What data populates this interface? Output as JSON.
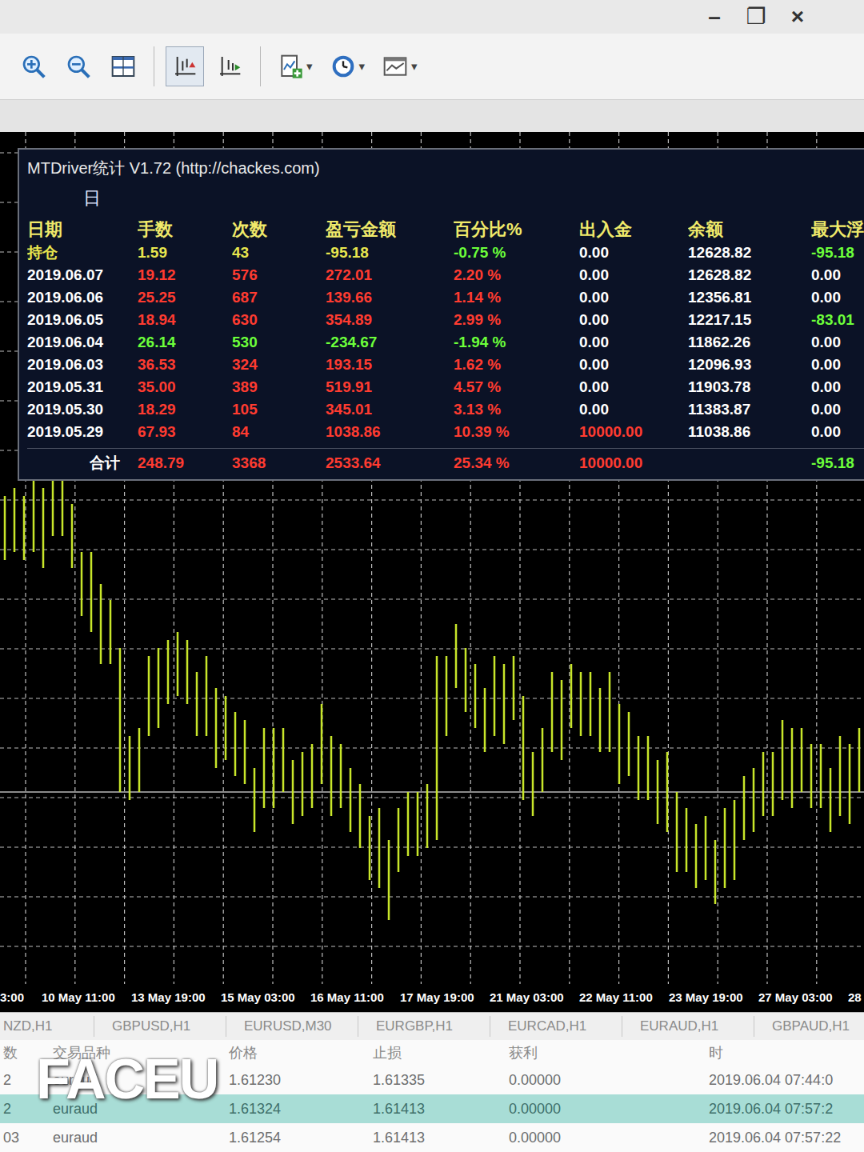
{
  "window": {
    "controls": [
      "–",
      "❐",
      "×"
    ]
  },
  "toolbar": {
    "buttons": [
      {
        "kind": "button",
        "selected": false
      },
      {
        "kind": "button",
        "selected": false
      },
      {
        "kind": "button",
        "selected": false
      },
      {
        "kind": "toggle",
        "selected": true
      },
      {
        "kind": "toggle",
        "selected": false
      },
      {
        "kind": "dropdown",
        "selected": false,
        "arrow": "▾"
      },
      {
        "kind": "dropdown",
        "selected": false,
        "arrow": "▾"
      },
      {
        "kind": "dropdown",
        "selected": false,
        "arrow": "▾"
      }
    ]
  },
  "stats_panel": {
    "title": "MTDriver统计 V1.72 (http://chackes.com)",
    "tab": "日",
    "columns": [
      "日期",
      "手数",
      "次数",
      "盈亏金额",
      "百分比%",
      "出入金",
      "余额",
      "最大浮"
    ],
    "rows": [
      {
        "cells": [
          "持仓",
          "1.59",
          "43",
          "-95.18",
          "-0.75 %",
          "0.00",
          "12628.82",
          "-95.18"
        ],
        "colors": [
          "#e8e64e",
          "#e8e64e",
          "#e8e64e",
          "#e8e64e",
          "#6cff3a",
          "#ffffff",
          "#ffffff",
          "#6cff3a"
        ]
      },
      {
        "cells": [
          "2019.06.07",
          "19.12",
          "576",
          "272.01",
          "2.20 %",
          "0.00",
          "12628.82",
          "0.00"
        ],
        "colors": [
          "#ffffff",
          "#ff3b30",
          "#ff3b30",
          "#ff3b30",
          "#ff3b30",
          "#ffffff",
          "#ffffff",
          "#ffffff"
        ]
      },
      {
        "cells": [
          "2019.06.06",
          "25.25",
          "687",
          "139.66",
          "1.14 %",
          "0.00",
          "12356.81",
          "0.00"
        ],
        "colors": [
          "#ffffff",
          "#ff3b30",
          "#ff3b30",
          "#ff3b30",
          "#ff3b30",
          "#ffffff",
          "#ffffff",
          "#ffffff"
        ]
      },
      {
        "cells": [
          "2019.06.05",
          "18.94",
          "630",
          "354.89",
          "2.99 %",
          "0.00",
          "12217.15",
          "-83.01"
        ],
        "colors": [
          "#ffffff",
          "#ff3b30",
          "#ff3b30",
          "#ff3b30",
          "#ff3b30",
          "#ffffff",
          "#ffffff",
          "#6cff3a"
        ]
      },
      {
        "cells": [
          "2019.06.04",
          "26.14",
          "530",
          "-234.67",
          "-1.94 %",
          "0.00",
          "11862.26",
          "0.00"
        ],
        "colors": [
          "#ffffff",
          "#6cff3a",
          "#6cff3a",
          "#6cff3a",
          "#6cff3a",
          "#ffffff",
          "#ffffff",
          "#ffffff"
        ]
      },
      {
        "cells": [
          "2019.06.03",
          "36.53",
          "324",
          "193.15",
          "1.62 %",
          "0.00",
          "12096.93",
          "0.00"
        ],
        "colors": [
          "#ffffff",
          "#ff3b30",
          "#ff3b30",
          "#ff3b30",
          "#ff3b30",
          "#ffffff",
          "#ffffff",
          "#ffffff"
        ]
      },
      {
        "cells": [
          "2019.05.31",
          "35.00",
          "389",
          "519.91",
          "4.57 %",
          "0.00",
          "11903.78",
          "0.00"
        ],
        "colors": [
          "#ffffff",
          "#ff3b30",
          "#ff3b30",
          "#ff3b30",
          "#ff3b30",
          "#ffffff",
          "#ffffff",
          "#ffffff"
        ]
      },
      {
        "cells": [
          "2019.05.30",
          "18.29",
          "105",
          "345.01",
          "3.13 %",
          "0.00",
          "11383.87",
          "0.00"
        ],
        "colors": [
          "#ffffff",
          "#ff3b30",
          "#ff3b30",
          "#ff3b30",
          "#ff3b30",
          "#ffffff",
          "#ffffff",
          "#ffffff"
        ]
      },
      {
        "cells": [
          "2019.05.29",
          "67.93",
          "84",
          "1038.86",
          "10.39 %",
          "10000.00",
          "11038.86",
          "0.00"
        ],
        "colors": [
          "#ffffff",
          "#ff3b30",
          "#ff3b30",
          "#ff3b30",
          "#ff3b30",
          "#ff3b30",
          "#ffffff",
          "#ffffff"
        ]
      }
    ],
    "total": {
      "cells": [
        "合计",
        "248.79",
        "3368",
        "2533.64",
        "25.34 %",
        "10000.00",
        null,
        "-95.18"
      ],
      "colors": [
        "#ffffff",
        "#ff3b30",
        "#ff3b30",
        "#ff3b30",
        "#ff3b30",
        "#ff3b30",
        "#ffffff",
        "#6cff3a"
      ]
    }
  },
  "chart": {
    "high": [
      61,
      62,
      61,
      64,
      62,
      64,
      64,
      60,
      54,
      54,
      50,
      48,
      42,
      31,
      32,
      41,
      42,
      43,
      44,
      43,
      39,
      41,
      37,
      36,
      34,
      33,
      27,
      32,
      32,
      32,
      28,
      29,
      30,
      35,
      31,
      30,
      27,
      25,
      21,
      22,
      18,
      22,
      24,
      24,
      25,
      41,
      41,
      45,
      42,
      40,
      37,
      41,
      40,
      41,
      36,
      29,
      32,
      39,
      38,
      40,
      39,
      39,
      37,
      39,
      35,
      34,
      31,
      31,
      28,
      29,
      24,
      22,
      20,
      21,
      18,
      22,
      23,
      26,
      27,
      29,
      29,
      33,
      32,
      32,
      30,
      30,
      27,
      31,
      30,
      32
    ],
    "low": [
      53,
      54,
      53,
      54,
      52,
      56,
      56,
      52,
      46,
      44,
      40,
      40,
      24,
      23,
      24,
      31,
      32,
      35,
      36,
      35,
      31,
      31,
      27,
      28,
      26,
      25,
      19,
      22,
      22,
      24,
      20,
      21,
      22,
      25,
      21,
      22,
      19,
      17,
      13,
      12,
      8,
      14,
      16,
      16,
      17,
      18,
      31,
      37,
      34,
      32,
      29,
      31,
      30,
      33,
      23,
      21,
      24,
      29,
      28,
      32,
      31,
      31,
      29,
      29,
      25,
      26,
      23,
      23,
      20,
      19,
      14,
      14,
      12,
      13,
      10,
      12,
      13,
      18,
      19,
      21,
      21,
      23,
      22,
      24,
      22,
      22,
      19,
      21,
      20,
      24
    ],
    "price_line": 24,
    "time_labels": [
      "3:00",
      "10 May 11:00",
      "13 May 19:00",
      "15 May 03:00",
      "16 May 11:00",
      "17 May 19:00",
      "21 May 03:00",
      "22 May 11:00",
      "23 May 19:00",
      "27 May 03:00",
      "28"
    ]
  },
  "symbol_tabs": [
    {
      "label": "NZD,H1",
      "selected": false
    },
    {
      "label": "GBPUSD,H1",
      "selected": false
    },
    {
      "label": "EURUSD,M30",
      "selected": false
    },
    {
      "label": "EURGBP,H1",
      "selected": false
    },
    {
      "label": "EURCAD,H1",
      "selected": false
    },
    {
      "label": "EURAUD,H1",
      "selected": false
    },
    {
      "label": "GBPAUD,H1",
      "selected": false
    }
  ],
  "orders": {
    "columns": [
      "数",
      "交易品种",
      "价格",
      "止损",
      "获利",
      "时"
    ],
    "rows": [
      {
        "cells": [
          "2",
          "euraud",
          "1.61230",
          "1.61335",
          "0.00000",
          "2019.06.04 07:44:0"
        ],
        "selected": false
      },
      {
        "cells": [
          "2",
          "euraud",
          "1.61324",
          "1.61413",
          "0.00000",
          "2019.06.04 07:57:2"
        ],
        "selected": true
      },
      {
        "cells": [
          "03",
          "euraud",
          "1.61254",
          "1.61413",
          "0.00000",
          "2019.06.04 07:57:22"
        ],
        "selected": false
      }
    ]
  },
  "watermark": "FACEU"
}
